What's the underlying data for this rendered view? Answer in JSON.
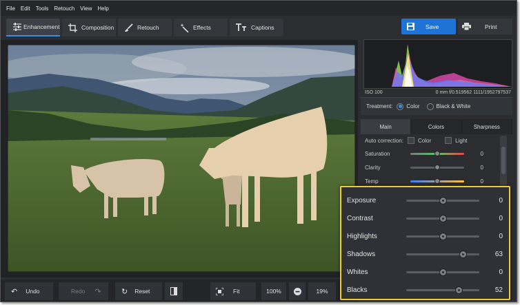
{
  "menu": [
    "File",
    "Edit",
    "Tools",
    "Retouch",
    "View",
    "Help"
  ],
  "tabs": [
    {
      "label": "Enhancement",
      "icon": "sliders-icon",
      "active": true
    },
    {
      "label": "Composition",
      "icon": "crop-icon",
      "active": false
    },
    {
      "label": "Retouch",
      "icon": "brush-icon",
      "active": false
    },
    {
      "label": "Effects",
      "icon": "magic-wand-icon",
      "active": false
    },
    {
      "label": "Captions",
      "icon": "text-icon",
      "active": false
    }
  ],
  "actions": {
    "save": "Save",
    "print": "Print"
  },
  "bottom": {
    "undo": "Undo",
    "redo": "Redo",
    "reset": "Reset",
    "fit": "Fit",
    "zoom100": "100%",
    "zoom_value": "19%"
  },
  "histogram": {
    "iso": "ISO 100",
    "info": "0 mm f/0.519562 1111/1952797537"
  },
  "treatment": {
    "label": "Treatment:",
    "color": "Color",
    "bw": "Black & White",
    "selected": "Color"
  },
  "panel_tabs": [
    {
      "label": "Main",
      "active": true
    },
    {
      "label": "Colors",
      "active": false
    },
    {
      "label": "Sharpness",
      "active": false
    }
  ],
  "auto_correction": {
    "label": "Auto correction:",
    "color": "Color",
    "light": "Light"
  },
  "small_sliders": [
    {
      "label": "Saturation",
      "value": "0",
      "level": 0.5
    },
    {
      "label": "Clarity",
      "value": "0",
      "level": 0.5
    },
    {
      "label": "Temp",
      "value": "0",
      "level": 0.5
    }
  ],
  "zoom_sliders": [
    {
      "label": "Exposure",
      "value": "0",
      "level": 0.5
    },
    {
      "label": "Contrast",
      "value": "0",
      "level": 0.5
    },
    {
      "label": "Highlights",
      "value": "0",
      "level": 0.5
    },
    {
      "label": "Shadows",
      "value": "63",
      "level": 0.78
    },
    {
      "label": "Whites",
      "value": "0",
      "level": 0.5
    },
    {
      "label": "Blacks",
      "value": "52",
      "level": 0.72
    }
  ],
  "colors": {
    "accent": "#1f73d6",
    "highlight_border": "#f2cd27",
    "panel": "#2b2d31"
  }
}
